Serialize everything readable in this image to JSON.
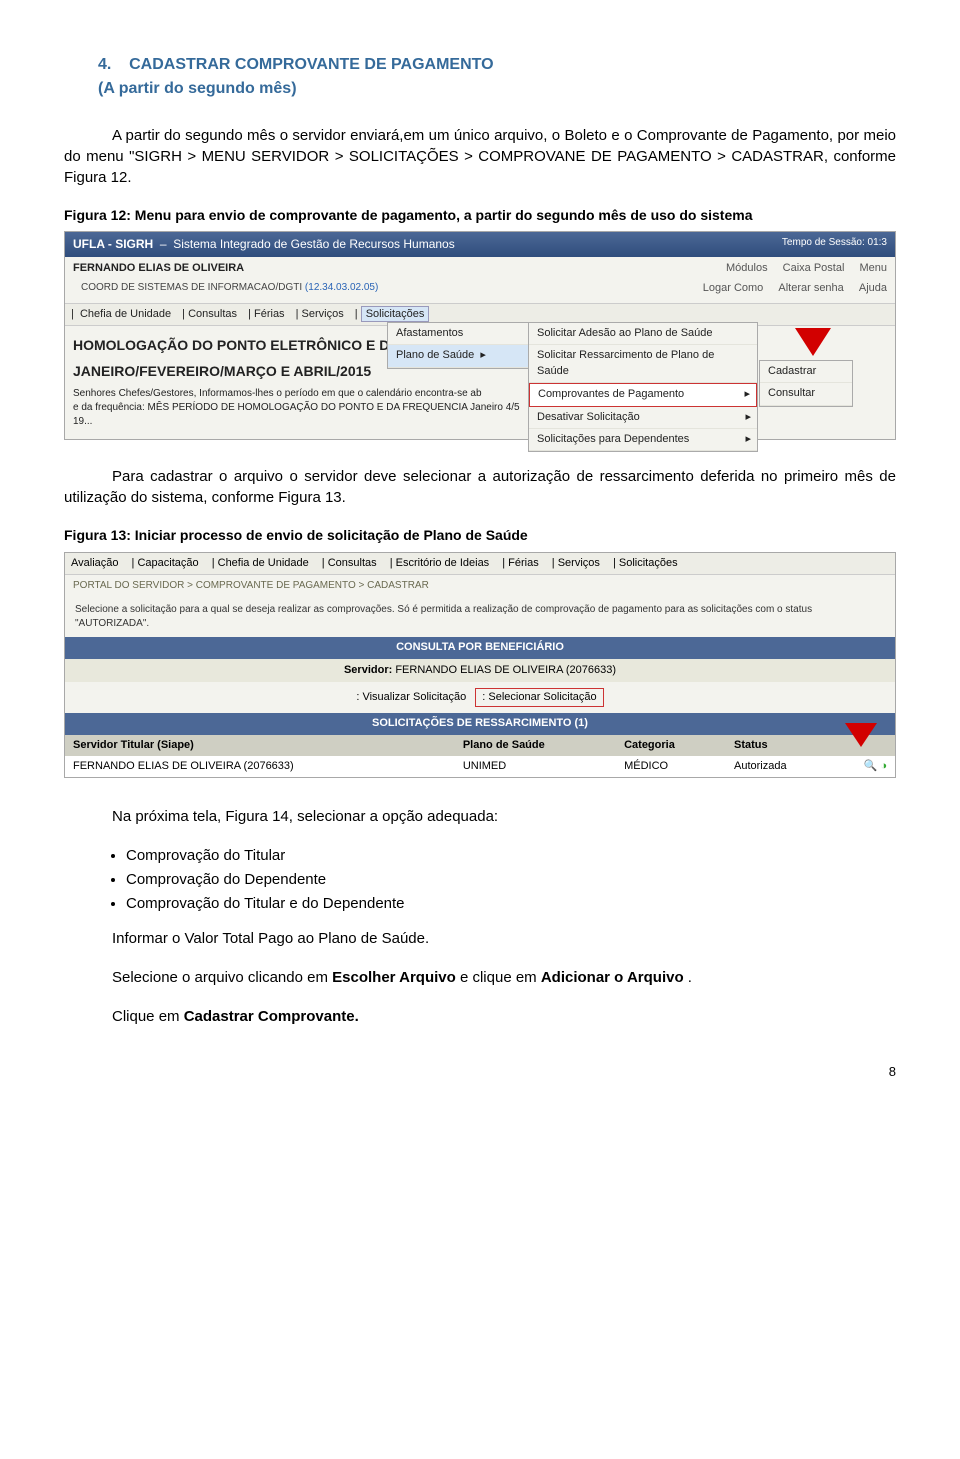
{
  "section": {
    "number": "4.",
    "title": "CADASTRAR COMPROVANTE DE PAGAMENTO",
    "subtitle": "(A partir do segundo mês)"
  },
  "para1": "A partir do segundo mês o servidor enviará,em um único arquivo, o Boleto e o Comprovante de Pagamento, por meio do menu \"SIGRH > MENU SERVIDOR > SOLICITAÇÕES > COMPROVANE DE PAGAMENTO > CADASTRAR, conforme Figura 12.",
  "fig12_caption": "Figura 12: Menu para envio de comprovante de pagamento, a partir do segundo mês de uso do sistema",
  "fig12": {
    "app_title": "UFLA - SIGRH",
    "app_full": "Sistema Integrado de Gestão de Recursos Humanos",
    "session": "Tempo de Sessão: 01:3",
    "user_name": "FERNANDO ELIAS DE OLIVEIRA",
    "coord": "COORD DE SISTEMAS DE INFORMACAO/DGTI",
    "coord_code": "(12.34.03.02.05)",
    "topmenu": {
      "modulos": "Módulos",
      "caixa": "Caixa Postal",
      "menu": "Menu",
      "logar": "Logar Como",
      "alterar": "Alterar senha",
      "ajuda": "Ajuda"
    },
    "menubar": {
      "chefia": "Chefia de Unidade",
      "consultas": "Consultas",
      "ferias": "Férias",
      "servicos": "Serviços",
      "solicitacoes": "Solicitações"
    },
    "submenu1": [
      "Afastamentos",
      "Plano de Saúde"
    ],
    "submenu2": [
      "Solicitar Adesão ao Plano de Saúde",
      "Solicitar Ressarcimento de Plano de Saúde",
      "Comprovantes de Pagamento",
      "Desativar Solicitação",
      "Solicitações para Dependentes"
    ],
    "submenu3": [
      "Cadastrar",
      "Consultar"
    ],
    "big1": "HOMOLOGAÇÃO DO PONTO ELETRÔNICO E DA FRI",
    "big2": "JANEIRO/FEVEREIRO/MARÇO E ABRIL/2015",
    "msg1": "Senhores Chefes/Gestores,    Informamos-lhes o período em que o calendário encontra-se ab",
    "msg2": "e da frequência: MÊS PERÍODO DE HOMOLOGAÇÃO DO PONTO E DA FREQUENCIA Janeiro 4/5",
    "msg3": "19..."
  },
  "para2": "Para cadastrar o arquivo o servidor deve selecionar a autorização de ressarcimento deferida no primeiro mês de utilização do sistema, conforme Figura 13.",
  "fig13_caption": "Figura 13: Iniciar processo de envio de solicitação de Plano de Saúde",
  "fig13": {
    "menubar2": [
      "Avaliação",
      "Capacitação",
      "Chefia de Unidade",
      "Consultas",
      "Escritório de Ideias",
      "Férias",
      "Serviços",
      "Solicitações"
    ],
    "crumb": "PORTAL DO SERVIDOR > COMPROVANTE DE PAGAMENTO > CADASTRAR",
    "note": "Selecione a solicitação para a qual se deseja realizar as comprovações. Só é permitida a realização de comprovação de pagamento para as solicitações com o status \"AUTORIZADA\".",
    "sec1": "CONSULTA POR BENEFICIÁRIO",
    "servidor_label": "Servidor:",
    "servidor_value": "FERNANDO ELIAS DE OLIVEIRA (2076633)",
    "leg_vis": ": Visualizar Solicitação",
    "leg_sel": ": Selecionar Solicitação",
    "sec2": "SOLICITAÇÕES DE RESSARCIMENTO (1)",
    "headers": [
      "Servidor Titular (Siape)",
      "Plano de Saúde",
      "Categoria",
      "Status"
    ],
    "row": [
      "FERNANDO ELIAS DE OLIVEIRA (2076633)",
      "UNIMED",
      "MÉDICO",
      "Autorizada"
    ]
  },
  "para3a": "Na próxima tela, Figura 14, selecionar a opção adequada:",
  "bullets": [
    "Comprovação do Titular",
    "Comprovação do Dependente",
    "Comprovação do Titular e do Dependente"
  ],
  "para3b": "Informar o Valor Total Pago ao Plano de Saúde.",
  "para3c_pre": "Selecione o arquivo clicando em ",
  "para3c_b1": "Escolher Arquivo",
  "para3c_mid": " e clique em ",
  "para3c_b2": "Adicionar o Arquivo",
  "para3c_post": ".",
  "para3d_pre": "Clique em ",
  "para3d_b": "Cadastrar Comprovante.",
  "page": "8"
}
